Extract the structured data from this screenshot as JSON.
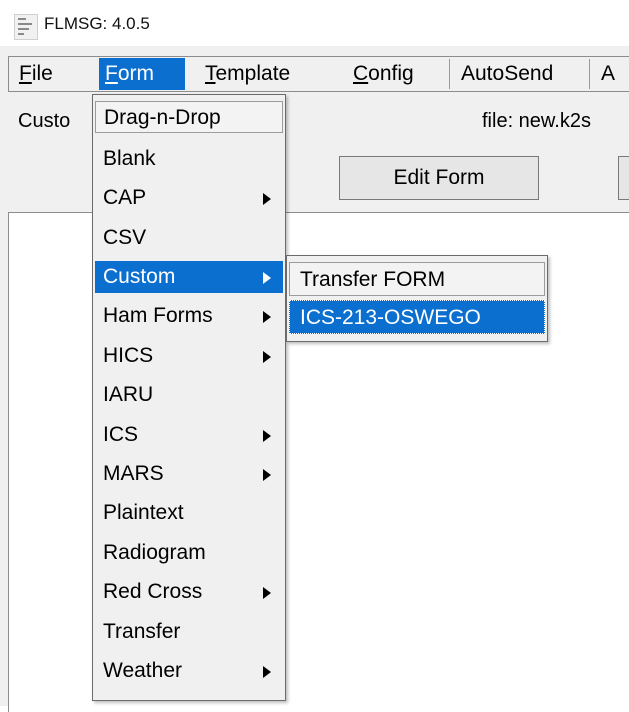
{
  "window": {
    "title": "FLMSG: 4.0.5"
  },
  "menubar": {
    "items": [
      {
        "label": "File",
        "mnemonic": "F",
        "rest": "ile"
      },
      {
        "label": "Form",
        "mnemonic": "F",
        "rest": "orm"
      },
      {
        "label": "Template",
        "mnemonic": "T",
        "rest": "emplate"
      },
      {
        "label": "Config",
        "mnemonic": "C",
        "rest": "onfig"
      },
      {
        "label": "AutoSend"
      },
      {
        "label": "A"
      }
    ]
  },
  "status": {
    "left": "Custo",
    "file": "file: new.k2s"
  },
  "toolbar": {
    "edit_form": "Edit Form"
  },
  "form_menu": {
    "items": [
      {
        "label": "Drag-n-Drop",
        "submenu": false
      },
      {
        "label": "Blank",
        "submenu": false
      },
      {
        "label": "CAP",
        "submenu": true
      },
      {
        "label": "CSV",
        "submenu": false
      },
      {
        "label": "Custom",
        "submenu": true,
        "highlighted": true
      },
      {
        "label": "Ham Forms",
        "submenu": true
      },
      {
        "label": "HICS",
        "submenu": true
      },
      {
        "label": "IARU",
        "submenu": false
      },
      {
        "label": "ICS",
        "submenu": true
      },
      {
        "label": "MARS",
        "submenu": true
      },
      {
        "label": "Plaintext",
        "submenu": false
      },
      {
        "label": "Radiogram",
        "submenu": false
      },
      {
        "label": "Red Cross",
        "submenu": true
      },
      {
        "label": "Transfer",
        "submenu": false
      },
      {
        "label": "Weather",
        "submenu": true
      }
    ]
  },
  "custom_submenu": {
    "items": [
      {
        "label": "Transfer FORM"
      },
      {
        "label": "ICS-213-OSWEGO",
        "highlighted": true
      }
    ]
  },
  "colors": {
    "highlight": "#0a6fcf",
    "background": "#f0f0f0"
  }
}
